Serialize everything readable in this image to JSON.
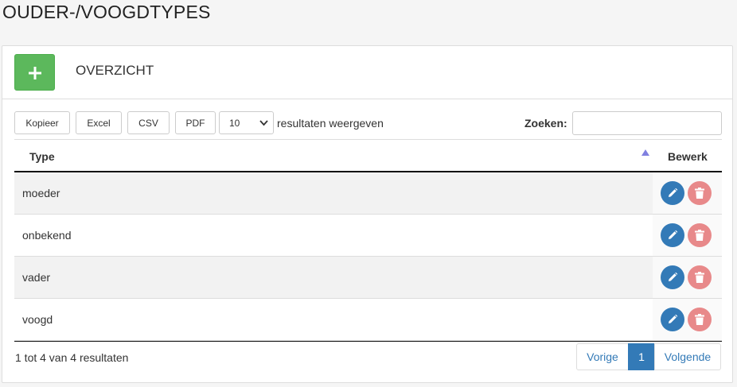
{
  "page": {
    "title": "OUDER-/VOOGDTYPES"
  },
  "panel": {
    "heading": "OVERZICHT",
    "add_icon": "plus-icon"
  },
  "toolbar": {
    "copy_label": "Kopieer",
    "excel_label": "Excel",
    "csv_label": "CSV",
    "pdf_label": "PDF",
    "length_value": "10",
    "length_suffix": "resultaten weergeven",
    "search_label": "Zoeken:",
    "search_value": ""
  },
  "table": {
    "columns": {
      "type": "Type",
      "edit": "Bewerk"
    },
    "sort": {
      "column": "Type",
      "direction": "ascending"
    },
    "rows": [
      {
        "type": "moeder"
      },
      {
        "type": "onbekend"
      },
      {
        "type": "vader"
      },
      {
        "type": "voogd"
      }
    ],
    "action_icons": {
      "edit": "pencil-icon",
      "delete": "trash-icon"
    }
  },
  "footer": {
    "info": "1 tot 4 van 4 resultaten",
    "prev_label": "Vorige",
    "current_page": "1",
    "next_label": "Volgende"
  },
  "colors": {
    "accent": "#337ab7",
    "add_button": "#5cb85c",
    "delete_button": "#e8898a"
  }
}
